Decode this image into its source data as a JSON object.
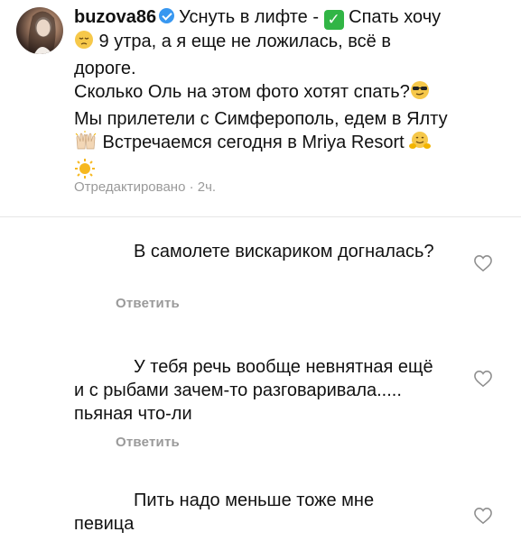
{
  "post": {
    "username": "buzova86",
    "caption_line1": "Уснуть в лифте - ",
    "caption_line1b": " Спать хочу",
    "caption_line2": " 9 утра, а я еще не ложилась, всё в",
    "caption_line3": "дороге.",
    "caption_line4": "Сколько Оль на этом фото хотят спать?",
    "caption_line5": "Мы прилетели с Симферополь, едем в Ялту",
    "caption_line6": " Встречаемся сегодня в Mriya Resort ",
    "meta": "Отредактировано · 2ч.",
    "icons": [
      "verified-badge-icon",
      "check-mark-emoji",
      "pensive-face-emoji",
      "sunglasses-face-emoji",
      "raised-hands-emoji",
      "hugging-face-emoji",
      "sun-emoji"
    ]
  },
  "comments": [
    {
      "text": "В самолете вискариком догналась?",
      "reply_label": "Ответить"
    },
    {
      "text": "У тебя речь вообще невнятная ещё и с рыбами зачем-то разговаривала..... пьяная что-ли",
      "reply_label": "Ответить"
    },
    {
      "text": "Пить надо меньше тоже мне певица"
    }
  ],
  "colors": {
    "meta_gray": "#9a9a9a",
    "verified_blue": "#3897f0",
    "check_green": "#31b545"
  }
}
